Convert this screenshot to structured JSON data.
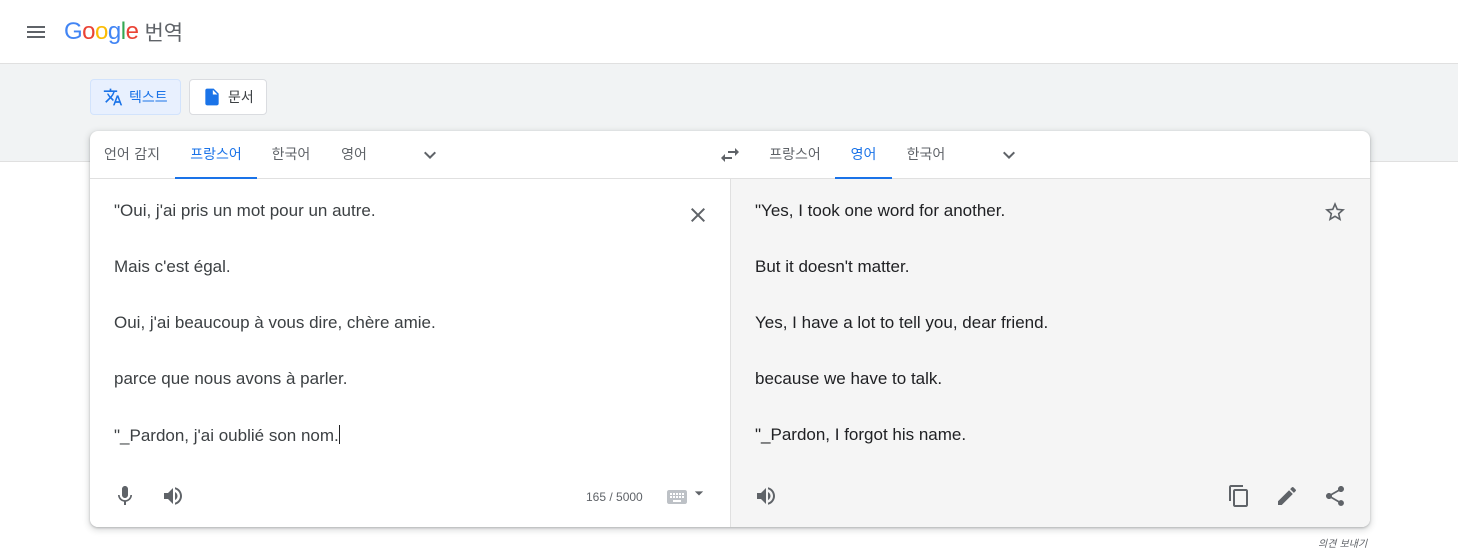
{
  "header": {
    "logo_text": "Google",
    "app_title": "번역",
    "menu_icon": "hamburger-menu-icon"
  },
  "modes": [
    {
      "label": "텍스트",
      "icon": "translate-icon",
      "active": true
    },
    {
      "label": "문서",
      "icon": "document-icon",
      "active": false
    }
  ],
  "source": {
    "tabs": [
      "언어 감지",
      "프랑스어",
      "한국어",
      "영어"
    ],
    "active_tab": "프랑스어",
    "lines": [
      "\"Oui, j'ai pris un mot pour un autre.",
      "Mais c'est égal.",
      "Oui, j'ai beaucoup à vous dire, chère amie.",
      "parce que nous avons à parler.",
      "\"_Pardon, j'ai oublié son nom."
    ],
    "char_count": "165 / 5000"
  },
  "target": {
    "tabs": [
      "프랑스어",
      "영어",
      "한국어"
    ],
    "active_tab": "영어",
    "lines": [
      "\"Yes, I took one word for another.",
      "But it doesn't matter.",
      "Yes, I have a lot to tell you, dear friend.",
      "because we have to talk.",
      "\"_Pardon, I forgot his name."
    ]
  },
  "feedback_link": "의견 보내기",
  "colors": {
    "accent": "#1a73e8",
    "active_bg": "#e8f0fe",
    "band_bg": "#f1f3f4",
    "target_bg": "#f5f5f5"
  }
}
